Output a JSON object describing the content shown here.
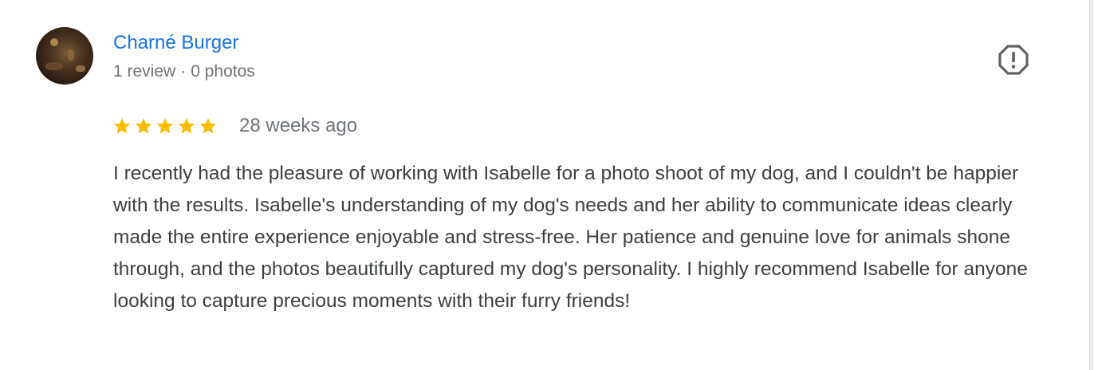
{
  "reviewer": {
    "name": "Charné Burger",
    "reviews_count_label": "1 review",
    "separator": "·",
    "photos_count_label": "0 photos",
    "avatar_icon": "profile-photo"
  },
  "review": {
    "rating": 5,
    "rating_max": 5,
    "time_ago": "28 weeks ago",
    "text": "I recently had the pleasure of working with Isabelle for a photo shoot of my dog, and I couldn't be happier with the results. Isabelle's understanding of my dog's needs and her ability to communicate ideas clearly made the entire experience enjoyable and stress-free. Her patience and genuine love for animals shone through, and the photos beautifully captured my dog's personality. I highly recommend Isabelle for anyone looking to capture precious moments with their furry friends!"
  },
  "actions": {
    "flag_icon": "report-flag-icon"
  },
  "colors": {
    "name_link": "#1a73e8",
    "star": "#fbbc04",
    "muted_text": "#70757a",
    "body_text": "#3c4043"
  }
}
